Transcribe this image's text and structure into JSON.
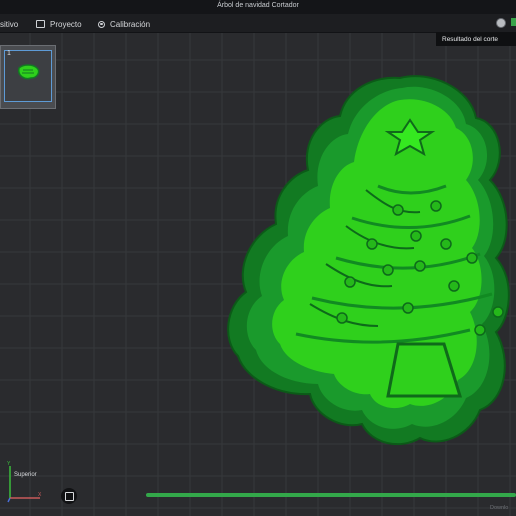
{
  "window": {
    "title": "Árbol de navidad Cortador"
  },
  "menubar": {
    "items": [
      {
        "label": "sitivo",
        "icon": ""
      },
      {
        "label": "Proyecto",
        "icon": "project-icon"
      },
      {
        "label": "Calibración",
        "icon": "calibration-icon"
      }
    ]
  },
  "tooltip": {
    "text": "Resultado del corte"
  },
  "plate": {
    "number": "1"
  },
  "view": {
    "axis_label": "Superior"
  },
  "slice": {
    "progress": 1.0
  },
  "footer": {
    "download_label": "Downlo"
  },
  "colors": {
    "bed": "#2a2b2e",
    "grid": "#3a3b3f",
    "model_light": "#33e61a",
    "model_dark": "#159a22",
    "cutter_outer": "#1f8f2e",
    "accent": "#33a84a"
  }
}
